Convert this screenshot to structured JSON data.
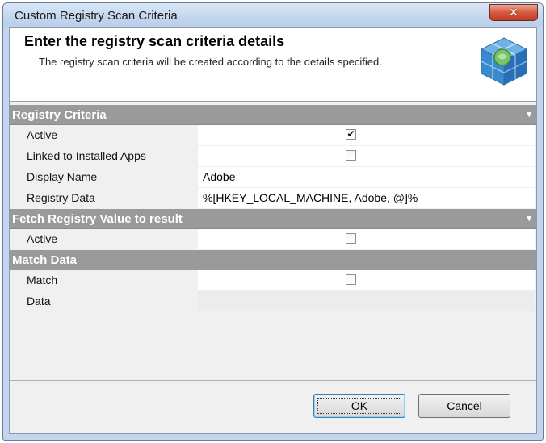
{
  "window": {
    "title": "Custom Registry Scan Criteria",
    "close_glyph": "✕"
  },
  "header": {
    "title": "Enter the registry scan criteria details",
    "description": "The registry scan criteria will be created according to the details specified.",
    "icon": "registry-cube-icon"
  },
  "sections": {
    "registry_criteria": {
      "title": "Registry Criteria",
      "collapse_glyph": "▾",
      "rows": {
        "active": {
          "label": "Active",
          "checked": true,
          "check_glyph": "✔"
        },
        "linked": {
          "label": "Linked to Installed Apps",
          "checked": false
        },
        "display_name": {
          "label": "Display Name",
          "value": "Adobe"
        },
        "registry_data": {
          "label": "Registry Data",
          "value": "%[HKEY_LOCAL_MACHINE, Adobe, @]%"
        }
      }
    },
    "fetch": {
      "title": "Fetch Registry Value to result",
      "collapse_glyph": "▾",
      "rows": {
        "active": {
          "label": "Active",
          "checked": false
        }
      }
    },
    "match": {
      "title": "Match Data",
      "rows": {
        "match": {
          "label": "Match",
          "checked": false
        },
        "data": {
          "label": "Data",
          "value": ""
        }
      }
    }
  },
  "buttons": {
    "ok": "OK",
    "cancel": "Cancel"
  },
  "colors": {
    "section_header": "#9a9a9a",
    "title_bar": "#c2d6ed",
    "close_button": "#d65a3e"
  }
}
